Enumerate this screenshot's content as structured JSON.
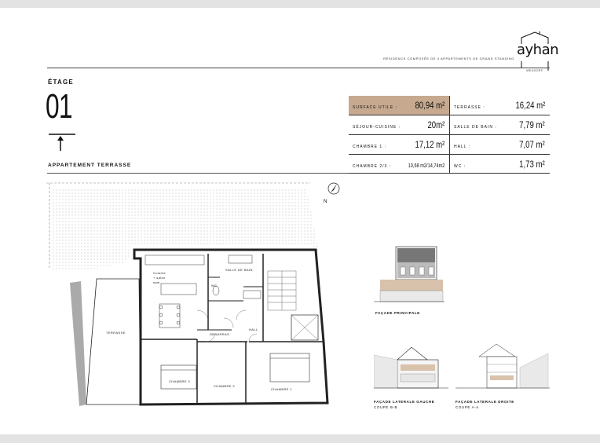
{
  "brand": {
    "logo_word": "ayhan",
    "logo_sub": "MEUDORF",
    "tagline": "RÉSIDENCE COMPOSÉE DE 4 APPARTEMENTS DE GRAND STANDING"
  },
  "header": {
    "etage_label": "ÉTAGE",
    "etage_number": "01",
    "apartment_label": "APPARTEMENT TERRASSE"
  },
  "surfaces": {
    "left": [
      {
        "label": "SURFACE UTILE :",
        "value": "80,94 m²"
      },
      {
        "label": "SÉJOUR-CUISINE :",
        "value": "20m²"
      },
      {
        "label": "CHAMBRE 1 :",
        "value": "17,12 m²"
      },
      {
        "label": "CHAMBRE 2/3 :",
        "value": "10,68 m2/14,74m2"
      }
    ],
    "right": [
      {
        "label": "TERRASSE :",
        "value": "16,24 m²"
      },
      {
        "label": "SALLE DE BAIN :",
        "value": "7,79 m²"
      },
      {
        "label": "HALL :",
        "value": "7,07 m²"
      },
      {
        "label": "WC :",
        "value": "1,73 m²"
      }
    ],
    "highlight_color": "#c6a98e"
  },
  "plan": {
    "north_label": "N",
    "rooms": {
      "cuisine": "Cuisine",
      "salon": "+ salon",
      "sam": "sam",
      "salle_de_bain": "SALLE DE BAIN",
      "wc": "WC",
      "debarras": "DEBARRAS",
      "hall": "HALL",
      "terrasse": "TERRASSE",
      "chambre3": "CHAMBRE 3",
      "chambre2": "CHAMBRE 2",
      "chambre1": "CHAMBRE 1"
    }
  },
  "facades": {
    "principale": "FAÇADE PRINCIPALE",
    "gauche_title": "FAÇADE LATERALE GAUCHE",
    "gauche_sub": "COUPE B-B",
    "droite_title": "FAÇADE LATERALE DROITE",
    "droite_sub": "COUPE A-A"
  }
}
